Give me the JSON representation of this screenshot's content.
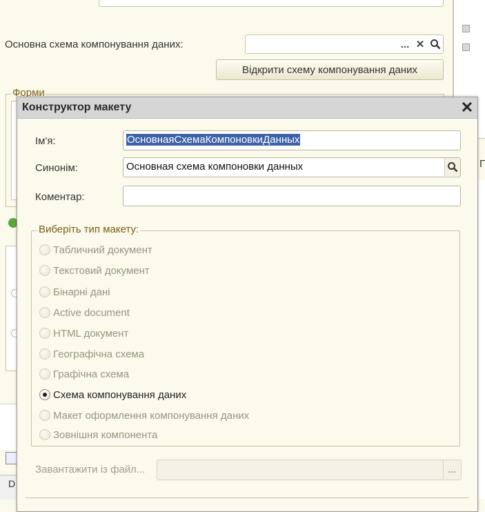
{
  "background_window": {
    "data_scheme_label": "Основна схема компонування даних:",
    "browse_button": "...",
    "clear_button": "✕",
    "open_scheme_button": "Відкрити схему компонування даних",
    "forms_group_title": "Форми",
    "bottom_tab_label": "D",
    "right_column_label": "П"
  },
  "dialog": {
    "title": "Конструктор макету",
    "close_icon": "close-icon",
    "name_label": "Ім'я:",
    "name_value": "ОсновнаяСхемаКомпоновкиДанных",
    "synonym_label": "Синонім:",
    "synonym_value": "Основная схема компоновки данных",
    "comment_label": "Коментар:",
    "comment_value": "",
    "type_group_title": "Виберіть тип макету:",
    "types": [
      {
        "label": "Табличний документ",
        "checked": false
      },
      {
        "label": "Текстовий документ",
        "checked": false
      },
      {
        "label": "Бінарні дані",
        "checked": false
      },
      {
        "label": "Active document",
        "checked": false
      },
      {
        "label": "HTML документ",
        "checked": false
      },
      {
        "label": "Географічна схема",
        "checked": false
      },
      {
        "label": "Графічна схема",
        "checked": false
      },
      {
        "label": "Схема компонування даних",
        "checked": true
      },
      {
        "label": "Макет оформлення компонування даних",
        "checked": false
      },
      {
        "label": "Зовнішня компонента",
        "checked": false
      }
    ],
    "load_from_file_label": "Завантажити із файл...",
    "load_browse_button": "..."
  },
  "colors": {
    "background": "#fbfaec",
    "selection": "#3d62a8",
    "group_title": "#7a5d14",
    "disabled_text": "#9a9480"
  }
}
